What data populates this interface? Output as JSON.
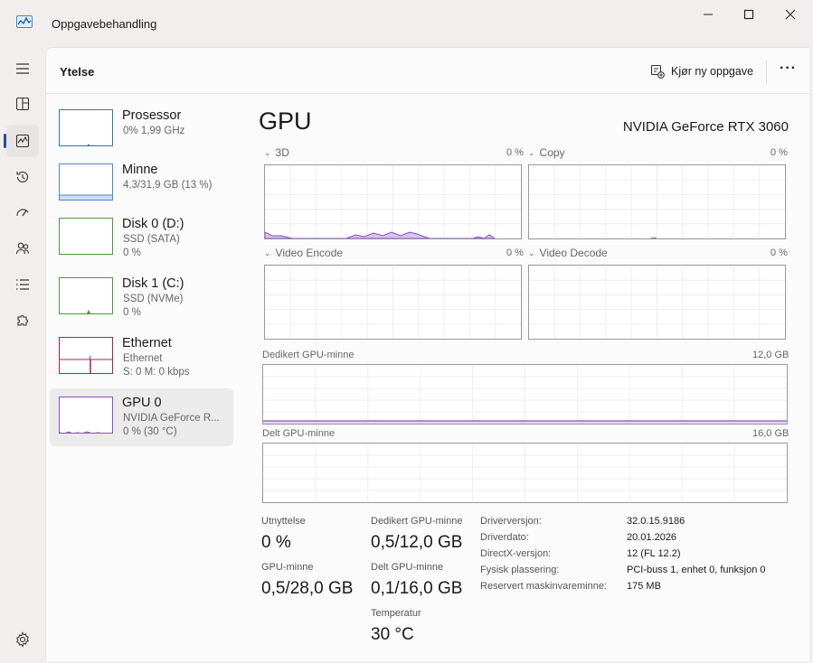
{
  "window": {
    "title": "Oppgavebehandling"
  },
  "header": {
    "page_title": "Ytelse",
    "new_task_label": "Kjør ny oppgave",
    "more_label": "···"
  },
  "devices": [
    {
      "name": "Prosessor",
      "sub1": "0%  1,99 GHz",
      "sub2": ""
    },
    {
      "name": "Minne",
      "sub1": "4,3/31,9 GB (13 %)",
      "sub2": ""
    },
    {
      "name": "Disk 0 (D:)",
      "sub1": "SSD (SATA)",
      "sub2": "0 %"
    },
    {
      "name": "Disk 1 (C:)",
      "sub1": "SSD (NVMe)",
      "sub2": "0 %"
    },
    {
      "name": "Ethernet",
      "sub1": "Ethernet",
      "sub2": "S: 0 M: 0 kbps"
    },
    {
      "name": "GPU 0",
      "sub1": "NVIDIA GeForce R...",
      "sub2": "0 %  (30 °C)"
    }
  ],
  "gpu": {
    "title": "GPU",
    "model": "NVIDIA GeForce RTX 3060",
    "engines": [
      {
        "name": "3D",
        "pct": "0 %"
      },
      {
        "name": "Copy",
        "pct": "0 %"
      },
      {
        "name": "Video Encode",
        "pct": "0 %"
      },
      {
        "name": "Video Decode",
        "pct": "0 %"
      }
    ],
    "dedicated_mem_label": "Dedikert GPU-minne",
    "dedicated_mem_max": "12,0 GB",
    "shared_mem_label": "Delt GPU-minne",
    "shared_mem_max": "16,0 GB"
  },
  "stats": {
    "util_label": "Utnyttelse",
    "util_value": "0 %",
    "ded_label": "Dedikert GPU-minne",
    "ded_value": "0,5/12,0 GB",
    "gpumem_label": "GPU-minne",
    "gpumem_value": "0,5/28,0 GB",
    "shared_label": "Delt GPU-minne",
    "shared_value": "0,1/16,0 GB",
    "temp_label": "Temperatur",
    "temp_value": "30 °C"
  },
  "info": [
    {
      "k": "Driverversjon:",
      "v": "32.0.15.9186"
    },
    {
      "k": "Driverdato:",
      "v": "20.01.2026"
    },
    {
      "k": "DirectX-versjon:",
      "v": "12 (FL 12.2)"
    },
    {
      "k": "Fysisk plassering:",
      "v": "PCI-buss 1, enhet 0, funksjon 0"
    },
    {
      "k": "Reservert maskinvareminne:",
      "v": "175 MB"
    }
  ],
  "colors": {
    "gpu": "#8a4fc4",
    "memory": "#4a8ac8",
    "disk": "#4a9a3a",
    "ethernet": "#a8205a",
    "cpu": "#2a7ab8",
    "accent": "#1f4fa8"
  }
}
